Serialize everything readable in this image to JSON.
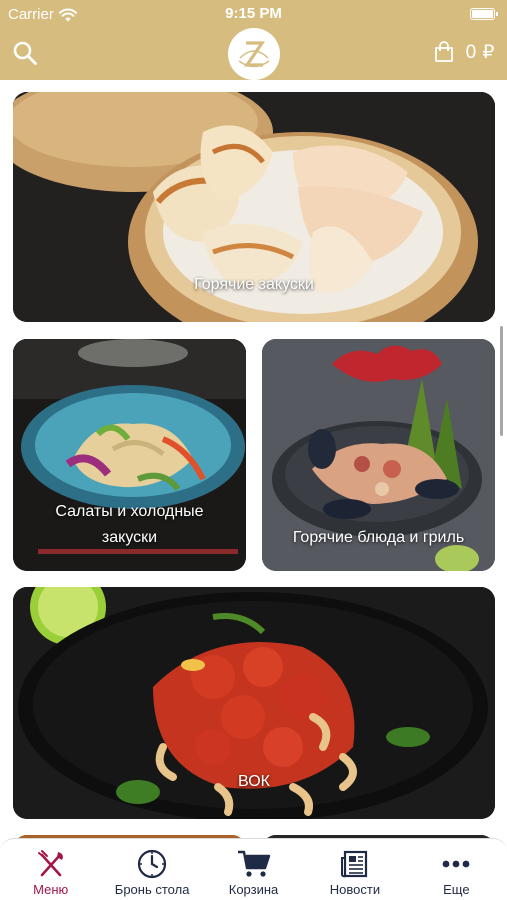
{
  "status_bar": {
    "carrier": "Carrier",
    "time": "9:15 PM"
  },
  "header": {
    "logo_letter": "Z",
    "cart_amount": "0 ₽",
    "background_color": "#d6bd7f"
  },
  "categories": [
    {
      "label": "Горячие закуски",
      "image": "steamed-dumplings-photo"
    },
    {
      "label_line1": "Салаты и холодные",
      "label_line2": "закуски",
      "image": "noodle-salad-photo"
    },
    {
      "label": "Горячие блюда и гриль",
      "image": "seafood-plate-photo"
    },
    {
      "label": "ВОК",
      "image": "wok-shrimp-cashew-photo"
    }
  ],
  "tabbar": {
    "active_color": "#a3164a",
    "items": [
      {
        "label": "Меню",
        "icon": "fork-knife-icon",
        "active": true
      },
      {
        "label": "Бронь стола",
        "icon": "clock-icon",
        "active": false
      },
      {
        "label": "Корзина",
        "icon": "cart-icon",
        "active": false
      },
      {
        "label": "Новости",
        "icon": "newspaper-icon",
        "active": false
      },
      {
        "label": "Еще",
        "icon": "more-dots-icon",
        "active": false
      }
    ]
  }
}
